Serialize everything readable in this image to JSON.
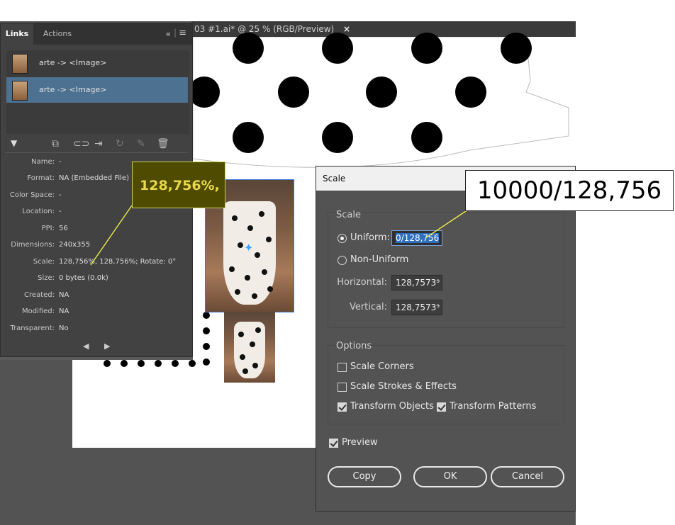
{
  "document_tab": {
    "title": "03 #1.ai* @ 25 % (RGB/Preview)",
    "close": "×"
  },
  "links_panel": {
    "tabs": [
      "Links",
      "Actions"
    ],
    "collapse_icon": "«",
    "menu_icon": "≡",
    "items": [
      {
        "label": "arte -> <Image>"
      },
      {
        "label": "arte -> <Image>"
      }
    ],
    "toolbar_icons": [
      "relink-from-cc-icon",
      "relink-icon",
      "go-to-link-icon",
      "update-link-icon",
      "edit-original-icon",
      "delete-icon"
    ],
    "info": [
      {
        "label": "Name:",
        "value": "-"
      },
      {
        "label": "Format:",
        "value": "NA (Embedded File)"
      },
      {
        "label": "Color Space:",
        "value": "-"
      },
      {
        "label": "Location:",
        "value": "-"
      },
      {
        "label": "PPI:",
        "value": "56"
      },
      {
        "label": "Dimensions:",
        "value": "240x355"
      },
      {
        "label": "Scale:",
        "value": "128,756%, 128,756%; Rotate: 0°"
      },
      {
        "label": "Size:",
        "value": "0 bytes (0.0k)"
      },
      {
        "label": "Created:",
        "value": "NA"
      },
      {
        "label": "Modified:",
        "value": "NA"
      },
      {
        "label": "Transparent:",
        "value": "No"
      }
    ],
    "nav_prev": "◀",
    "nav_next": "▶"
  },
  "callouts": {
    "left": "128,756%,",
    "right": "10000/128,756"
  },
  "scale_dialog": {
    "title": "Scale",
    "scale_group_title": "Scale",
    "uniform_label": "Uniform:",
    "uniform_value": "0/128,756",
    "nonuniform_label": "Non-Uniform",
    "horizontal_label": "Horizontal:",
    "horizontal_value": "128,7573⁹",
    "vertical_label": "Vertical:",
    "vertical_value": "128,7573⁹",
    "options_title": "Options",
    "scale_corners": "Scale Corners",
    "scale_strokes": "Scale Strokes & Effects",
    "transform_objects": "Transform Objects",
    "transform_patterns": "Transform Patterns",
    "preview": "Preview",
    "copy": "Copy",
    "ok": "OK",
    "cancel": "Cancel"
  }
}
